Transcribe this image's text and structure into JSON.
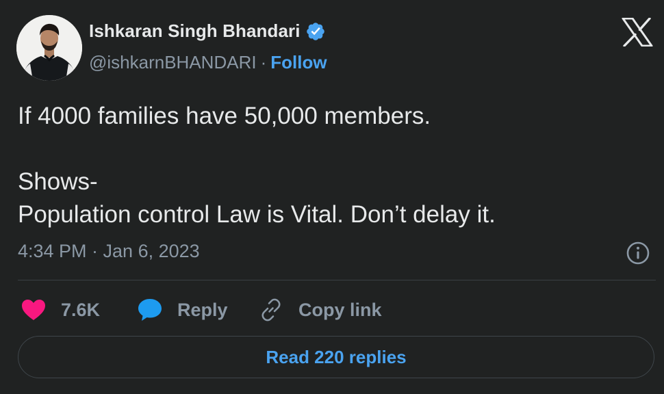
{
  "author": {
    "display_name": "Ishkaran Singh Bhandari",
    "handle": "@ishkarnBHANDARI",
    "separator": "·",
    "follow_label": "Follow",
    "verified_icon": "verified-badge-icon",
    "verified_color": "#4aa3f0"
  },
  "brand": {
    "logo_icon": "x-logo-icon"
  },
  "tweet": {
    "lines": [
      "If 4000 families have 50,000 members.",
      "",
      "Shows-",
      "Population control Law is Vital. Don’t delay it."
    ],
    "timestamp": "4:34 PM · Jan 6, 2023"
  },
  "actions": {
    "like": {
      "icon": "heart-icon",
      "count": "7.6K",
      "color": "#f91880"
    },
    "reply": {
      "icon": "speech-bubble-icon",
      "label": "Reply",
      "color": "#1d9bf0"
    },
    "copy_link": {
      "icon": "link-icon",
      "label": "Copy link"
    }
  },
  "footer": {
    "read_replies_label": "Read 220 replies"
  },
  "colors": {
    "background": "#202222",
    "text": "#e7e9ea",
    "muted": "#8b98a5",
    "accent": "#4aa3f0"
  }
}
